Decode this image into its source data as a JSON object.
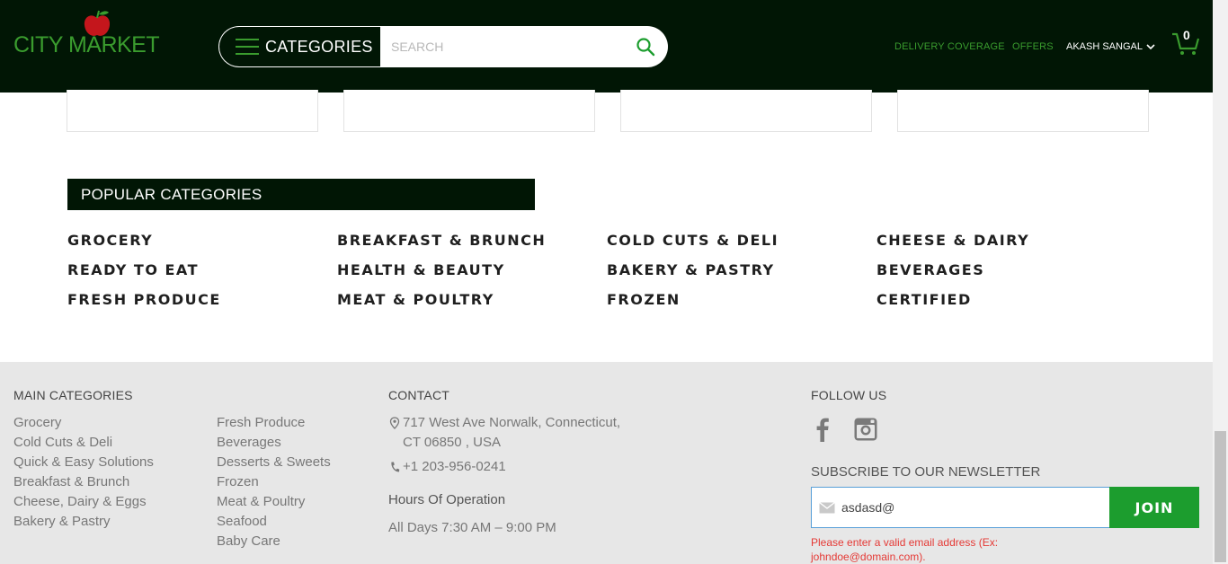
{
  "header": {
    "logo_text": "CITY MARKET",
    "categories_label": "CATEGORIES",
    "search_placeholder": "SEARCH",
    "delivery_label": "DELIVERY COVERAGE",
    "offers_label": "OFFERS",
    "user_name": "AKASH SANGAL",
    "cart_count": "0",
    "icons": [
      "apple-logo-icon",
      "hamburger-icon",
      "search-icon",
      "chevron-down-icon",
      "cart-icon"
    ],
    "colors": {
      "bar": "#011605",
      "accent": "#3a9c2e"
    }
  },
  "popular": {
    "title": "POPULAR CATEGORIES",
    "items": [
      "GROCERY",
      "BREAKFAST & BRUNCH",
      "COLD CUTS & DELI",
      "CHEESE & DAIRY",
      "READY TO EAT",
      "HEALTH & BEAUTY",
      "BAKERY & PASTRY",
      "BEVERAGES",
      "FRESH PRODUCE",
      "MEAT & POULTRY",
      "FROZEN",
      "CERTIFIED"
    ]
  },
  "footer": {
    "main_title": "MAIN CATEGORIES",
    "col1": [
      "Grocery",
      "Cold Cuts & Deli",
      "Quick & Easy Solutions",
      "Breakfast & Brunch",
      "Cheese, Dairy & Eggs",
      "Bakery & Pastry"
    ],
    "col2": [
      "Fresh Produce",
      "Beverages",
      "Desserts & Sweets",
      "Frozen",
      "Meat & Poultry",
      "Seafood",
      "Baby Care"
    ],
    "contact_title": "CONTACT",
    "address_line1": "717 West Ave Norwalk, Connecticut,",
    "address_line2": "CT 06850 , USA",
    "phone": "+1 203-956-0241",
    "hours_title": "Hours Of Operation",
    "hours_text": "All Days 7:30 AM – 9:00 PM",
    "follow_title": "FOLLOW US",
    "newsletter_title": "SUBSCRIBE TO OUR NEWSLETTER",
    "newsletter_value": "asdasd@",
    "join_label": "JOIN",
    "error_text": "Please enter a valid email address (Ex: johndoe@domain.com).",
    "icons": [
      "location-pin-icon",
      "phone-icon",
      "facebook-icon",
      "instagram-icon",
      "mail-icon"
    ],
    "colors": {
      "join": "#1c9d2e",
      "error": "#e53935",
      "input_border": "#58a0d8"
    }
  }
}
